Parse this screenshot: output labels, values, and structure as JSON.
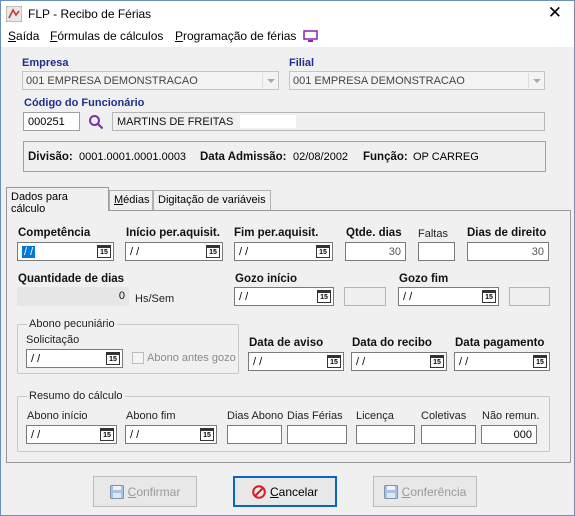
{
  "window": {
    "title": "FLP - Recibo de Férias",
    "close": "✕"
  },
  "menu": {
    "items": [
      {
        "label": "Saída",
        "accel": "S",
        "rest": "aída"
      },
      {
        "label": "Fórmulas de cálculos",
        "accel": "F",
        "rest": "órmulas de cálculos"
      },
      {
        "label": "Programação de férias",
        "accel": "P",
        "rest": "rogramação de férias"
      }
    ]
  },
  "header": {
    "empresa_label": "Empresa",
    "empresa_value": "001 EMPRESA DEMONSTRACAO",
    "filial_label": "Filial",
    "filial_value": "001 EMPRESA DEMONSTRACAO",
    "codigo_label": "Código do Funcionário",
    "codigo_value": "000251",
    "nome_value": "MARTINS DE FREITAS"
  },
  "info": {
    "divisao_label": "Divisão:",
    "divisao_value": "0001.0001.0001.0003",
    "admissao_label": "Data Admissão:",
    "admissao_value": "02/08/2002",
    "funcao_label": "Função:",
    "funcao_value": "OP CARREG"
  },
  "tabs": [
    {
      "label": "Dados para cálculo",
      "accel": "",
      "active": true
    },
    {
      "label": "Médias",
      "accel": "M",
      "rest": "édias"
    },
    {
      "label": "Digitação de variáveis",
      "accel": "",
      "rest": ""
    }
  ],
  "calc": {
    "competencia_label": "Competência",
    "competencia_value": "/ /",
    "inicio_per_label": "Início per.aquisit.",
    "inicio_per_value": "/ /",
    "fim_per_label": "Fim per.aquisit.",
    "fim_per_value": "/ /",
    "qtde_dias_label": "Qtde. dias",
    "qtde_dias_value": "30",
    "faltas_label": "Faltas",
    "faltas_value": "",
    "dias_direito_label": "Dias de direito",
    "dias_direito_value": "30",
    "quantidade_dias_label": "Quantidade de dias",
    "quantidade_dias_value": "0",
    "hs_sem_label": "Hs/Sem",
    "gozo_inicio_label": "Gozo início",
    "gozo_inicio_value": "/ /",
    "gozo_fim_label": "Gozo fim",
    "gozo_fim_value": "/ /",
    "abono_group_title": "Abono pecuniário",
    "solicitacao_label": "Solicitação",
    "solicitacao_value": "/ /",
    "abono_antes_label": "Abono antes gozo",
    "data_aviso_label": "Data de aviso",
    "data_aviso_value": "/ /",
    "data_recibo_label": "Data do recibo",
    "data_recibo_value": "/ /",
    "data_pagamento_label": "Data pagamento",
    "data_pagamento_value": "/ /",
    "cal_glyph": "15"
  },
  "resumo": {
    "title": "Resumo do cálculo",
    "abono_inicio_label": "Abono início",
    "abono_inicio_value": "/ /",
    "abono_fim_label": "Abono fim",
    "abono_fim_value": "/ /",
    "dias_abono_label": "Dias Abono",
    "dias_ferias_label": "Dias Férias",
    "licenca_label": "Licença",
    "coletivas_label": "Coletivas",
    "nao_remun_label": "Não remun.",
    "nao_remun_value": "000"
  },
  "buttons": {
    "confirmar": {
      "label": "Confirmar",
      "accel": "C",
      "rest": "onfirmar"
    },
    "cancelar": {
      "label": "Cancelar",
      "accel": "C",
      "rest": "ancelar"
    },
    "conferencia": {
      "label": "Conferência",
      "accel": "C",
      "rest": "onferência"
    }
  },
  "colors": {
    "label_blue": "#1f2f8f",
    "selection": "#0078d7",
    "cancel_red": "#d81e1e",
    "default_border": "#0a64c8"
  }
}
